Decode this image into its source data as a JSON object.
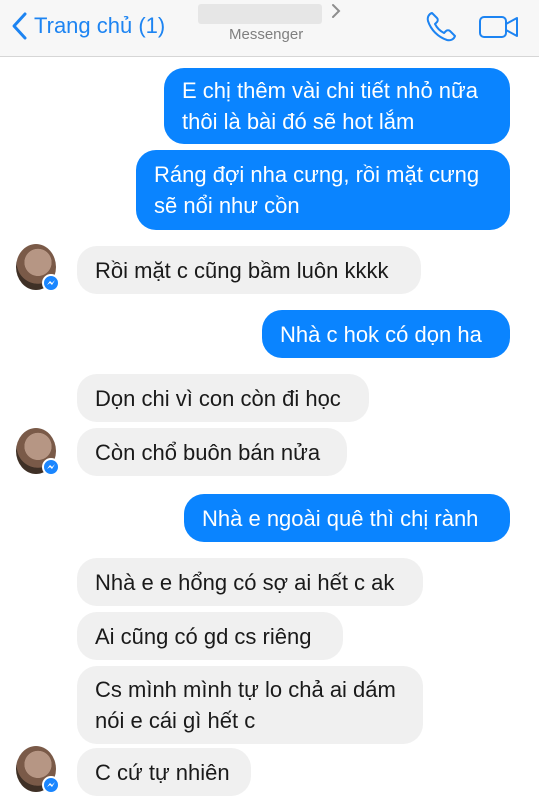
{
  "header": {
    "back_label": "Trang chủ (1)",
    "subtitle": "Messenger",
    "accent_color": "#1d84f2"
  },
  "messages": [
    {
      "side": "out",
      "lines": [
        "E chị thêm vài chi tiết nhỏ nữa",
        "thôi là bài đó sẽ hot lắm"
      ]
    },
    {
      "side": "out",
      "lines": [
        "Ráng đợi nha cưng, rồi mặt cưng",
        "sẽ nổi như cồn"
      ]
    },
    {
      "side": "in",
      "lines": [
        "Rồi mặt c cũng bầm luôn kkkk"
      ]
    },
    {
      "side": "out",
      "lines": [
        "Nhà c hok có dọn ha"
      ]
    },
    {
      "side": "in",
      "lines": [
        "Dọn chi vì con còn đi học"
      ]
    },
    {
      "side": "in",
      "lines": [
        "Còn chổ buôn bán nửa"
      ]
    },
    {
      "side": "out",
      "lines": [
        "Nhà e ngoài quê thì chị rành"
      ]
    },
    {
      "side": "in",
      "lines": [
        "Nhà e e hổng có sợ ai hết c ak"
      ]
    },
    {
      "side": "in",
      "lines": [
        "Ai cũng có gd cs riêng"
      ]
    },
    {
      "side": "in",
      "lines": [
        "Cs mình mình tự lo chả ai dám",
        "nói e cái gì hết c"
      ]
    },
    {
      "side": "in",
      "lines": [
        "C cứ tự nhiên"
      ]
    }
  ],
  "colors": {
    "outgoing_bubble": "#0a84ff",
    "incoming_bubble": "#f0f0f0",
    "messenger_badge": "#1a86ff"
  },
  "icons": [
    "chevron-left-icon",
    "chevron-right-icon",
    "phone-icon",
    "video-camera-icon",
    "messenger-badge-icon"
  ]
}
